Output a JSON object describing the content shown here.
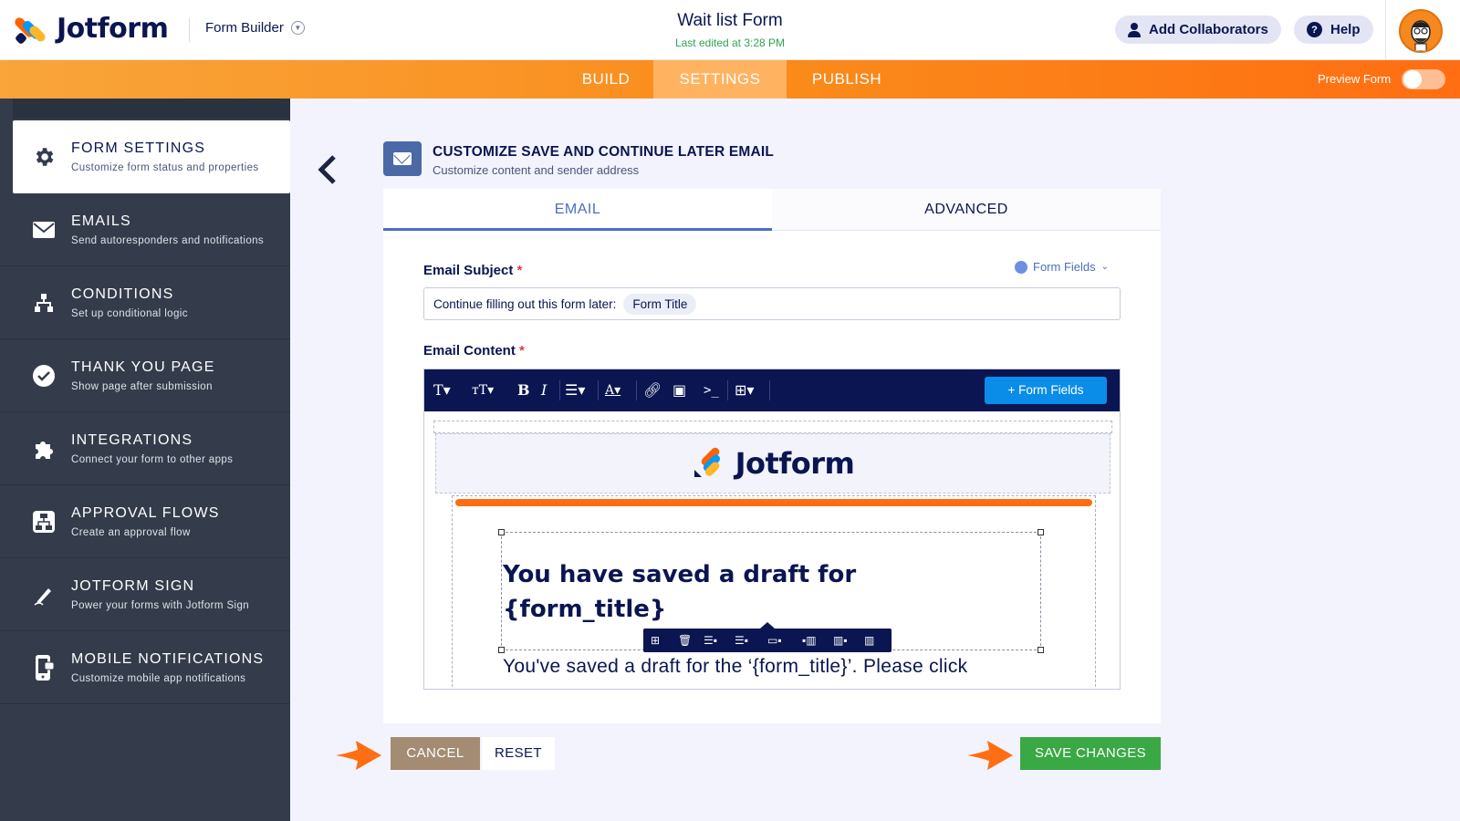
{
  "header": {
    "brand": "Jotform",
    "builder_label": "Form Builder",
    "form_title": "Wait list Form",
    "last_edited": "Last edited at 3:28 PM",
    "add_collaborators": "Add Collaborators",
    "help": "Help"
  },
  "nav": {
    "tabs": [
      "BUILD",
      "SETTINGS",
      "PUBLISH"
    ],
    "active_tab": "SETTINGS",
    "preview_label": "Preview Form",
    "preview_on": false
  },
  "sidebar": {
    "items": [
      {
        "title": "FORM SETTINGS",
        "subtitle": "Customize form status and properties",
        "icon": "gear-icon",
        "active": true
      },
      {
        "title": "EMAILS",
        "subtitle": "Send autoresponders and notifications",
        "icon": "envelope-icon"
      },
      {
        "title": "CONDITIONS",
        "subtitle": "Set up conditional logic",
        "icon": "sitemap-icon"
      },
      {
        "title": "THANK YOU PAGE",
        "subtitle": "Show page after submission",
        "icon": "check-circle-icon"
      },
      {
        "title": "INTEGRATIONS",
        "subtitle": "Connect your form to other apps",
        "icon": "puzzle-icon"
      },
      {
        "title": "APPROVAL FLOWS",
        "subtitle": "Create an approval flow",
        "icon": "flow-icon"
      },
      {
        "title": "JOTFORM SIGN",
        "subtitle": "Power your forms with Jotform Sign",
        "icon": "pen-icon"
      },
      {
        "title": "MOBILE NOTIFICATIONS",
        "subtitle": "Customize mobile app notifications",
        "icon": "mobile-icon"
      }
    ]
  },
  "content": {
    "title": "CUSTOMIZE SAVE AND CONTINUE LATER EMAIL",
    "subtitle": "Customize content and sender address",
    "tabs": [
      "EMAIL",
      "ADVANCED"
    ],
    "active_tab": "EMAIL",
    "subject_label": "Email Subject",
    "form_fields_link": "Form Fields",
    "subject_text": "Continue filling out this form later:",
    "subject_chip": "Form Title",
    "content_label": "Email Content",
    "toolbar_form_fields": "+ Form Fields",
    "email_brand": "Jotform",
    "email_heading_line1": "You have saved a draft for",
    "email_heading_line2": "{form_title}",
    "email_body": "You've saved a draft for the ‘{form_title}’. Please click"
  },
  "footer": {
    "cancel": "CANCEL",
    "reset": "RESET",
    "save": "SAVE CHANGES"
  },
  "colors": {
    "navy": "#0a1551",
    "orange": "#ff6e12",
    "sidebar": "#343c4b",
    "accent_blue": "#4a6ec3",
    "save_green": "#3aa844",
    "cancel_tan": "#a38c73"
  }
}
